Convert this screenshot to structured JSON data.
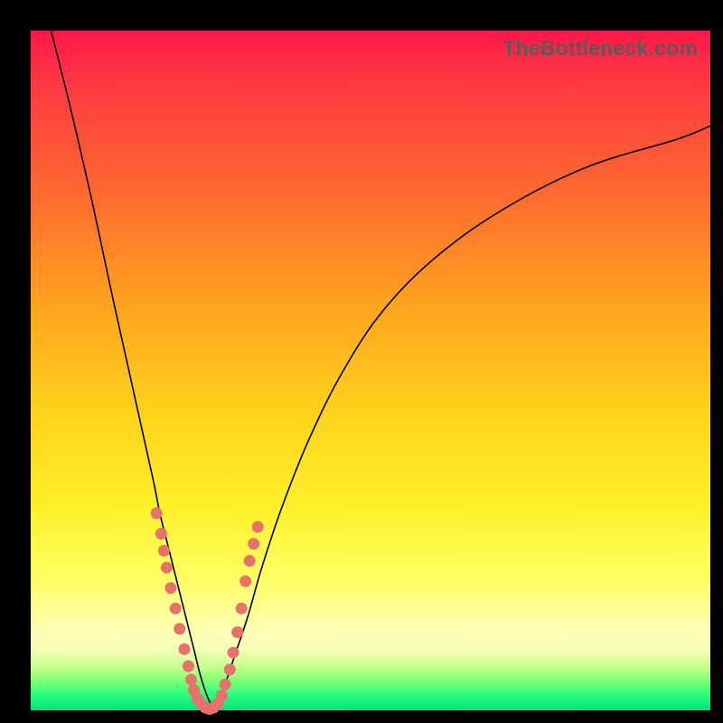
{
  "watermark": "TheBottleneck.com",
  "colors": {
    "background": "#000000",
    "gradient_top": "#ff1749",
    "gradient_mid": "#ffd21c",
    "gradient_bottom": "#00e47a",
    "curve": "#000000",
    "dot": "#e9716b"
  },
  "chart_data": {
    "type": "line",
    "title": "",
    "xlabel": "",
    "ylabel": "",
    "xlim": [
      0,
      100
    ],
    "ylim": [
      0,
      100
    ],
    "note": "Unlabeled bottleneck chart. Two curves descend into a V near x≈25 and rise again; y is a qualitative bottleneck score (red=high, green=low). Values estimated from pixels.",
    "series": [
      {
        "name": "left-curve",
        "x": [
          3,
          6,
          9,
          12,
          14,
          16,
          18,
          19,
          20,
          21,
          22,
          23,
          24,
          25,
          26,
          27
        ],
        "y": [
          100,
          88,
          75,
          61,
          52,
          43,
          34,
          29,
          25,
          21,
          17,
          13,
          9,
          5,
          2,
          0
        ]
      },
      {
        "name": "right-curve",
        "x": [
          27,
          28,
          29,
          30,
          32,
          34,
          37,
          41,
          46,
          52,
          60,
          70,
          82,
          95,
          100
        ],
        "y": [
          0,
          2,
          5,
          8,
          14,
          21,
          30,
          40,
          50,
          59,
          67,
          74,
          80,
          84,
          86
        ]
      }
    ],
    "scatter": {
      "name": "dots",
      "x": [
        18.5,
        19.2,
        19.6,
        20.0,
        20.6,
        21.3,
        21.9,
        22.6,
        23.2,
        23.6,
        24.0,
        24.5,
        25.1,
        25.7,
        26.3,
        26.9,
        27.5,
        28.1,
        28.6,
        29.3,
        29.8,
        30.4,
        31.0,
        31.6,
        32.2,
        32.8,
        33.4
      ],
      "y": [
        29.0,
        26.0,
        23.5,
        21.0,
        18.0,
        15.0,
        12.0,
        9.0,
        6.5,
        4.5,
        3.0,
        1.8,
        0.9,
        0.4,
        0.2,
        0.4,
        1.0,
        2.2,
        3.8,
        6.0,
        8.5,
        11.5,
        15.0,
        19.0,
        22.0,
        24.5,
        27.0
      ]
    }
  }
}
